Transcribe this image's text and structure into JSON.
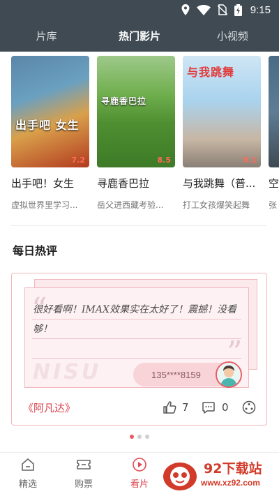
{
  "status_bar": {
    "time": "9:15",
    "icons": [
      "location-icon",
      "wifi-icon",
      "no-sim-icon",
      "battery-charging-icon"
    ]
  },
  "top_tabs": [
    {
      "label": "片库",
      "active": false
    },
    {
      "label": "热门影片",
      "active": true
    },
    {
      "label": "小视频",
      "active": false
    }
  ],
  "movies": [
    {
      "title": "出手吧！女生",
      "desc": "虚拟世界里学习...",
      "rating": "7.2",
      "poster_text": "出手吧 女生"
    },
    {
      "title": "寻鹿香巴拉",
      "desc": "岳父进西藏考验...",
      "rating": "8.5",
      "poster_text": "寻鹿香巴拉"
    },
    {
      "title": "与我跳舞（普...",
      "desc": "打工女孩爆笑起舞",
      "rating": "9.1",
      "poster_text": "与我跳舞"
    },
    {
      "title": "空",
      "desc": "张",
      "rating": "",
      "poster_text": ""
    }
  ],
  "section": {
    "title": "每日热评"
  },
  "review": {
    "text": "很好看啊！IMAX效果实在太好了！震撼！没看够！",
    "user": "135****8159",
    "movie": "《阿凡达》",
    "likes": "7",
    "comments": "0",
    "watermark": "NISU"
  },
  "carousel": {
    "dots": 3,
    "active": 0
  },
  "bottom_nav": [
    {
      "label": "精选",
      "icon": "home-icon",
      "active": false
    },
    {
      "label": "购票",
      "icon": "ticket-icon",
      "active": false
    },
    {
      "label": "看片",
      "icon": "play-circle-icon",
      "active": true
    }
  ],
  "logo": {
    "title": "92下载站",
    "url": "www.xz92.com"
  },
  "colors": {
    "header_bg": "#3f4a52",
    "accent": "#e04b55",
    "rating": "#ff6b57",
    "card_border": "#f2b7bd"
  }
}
